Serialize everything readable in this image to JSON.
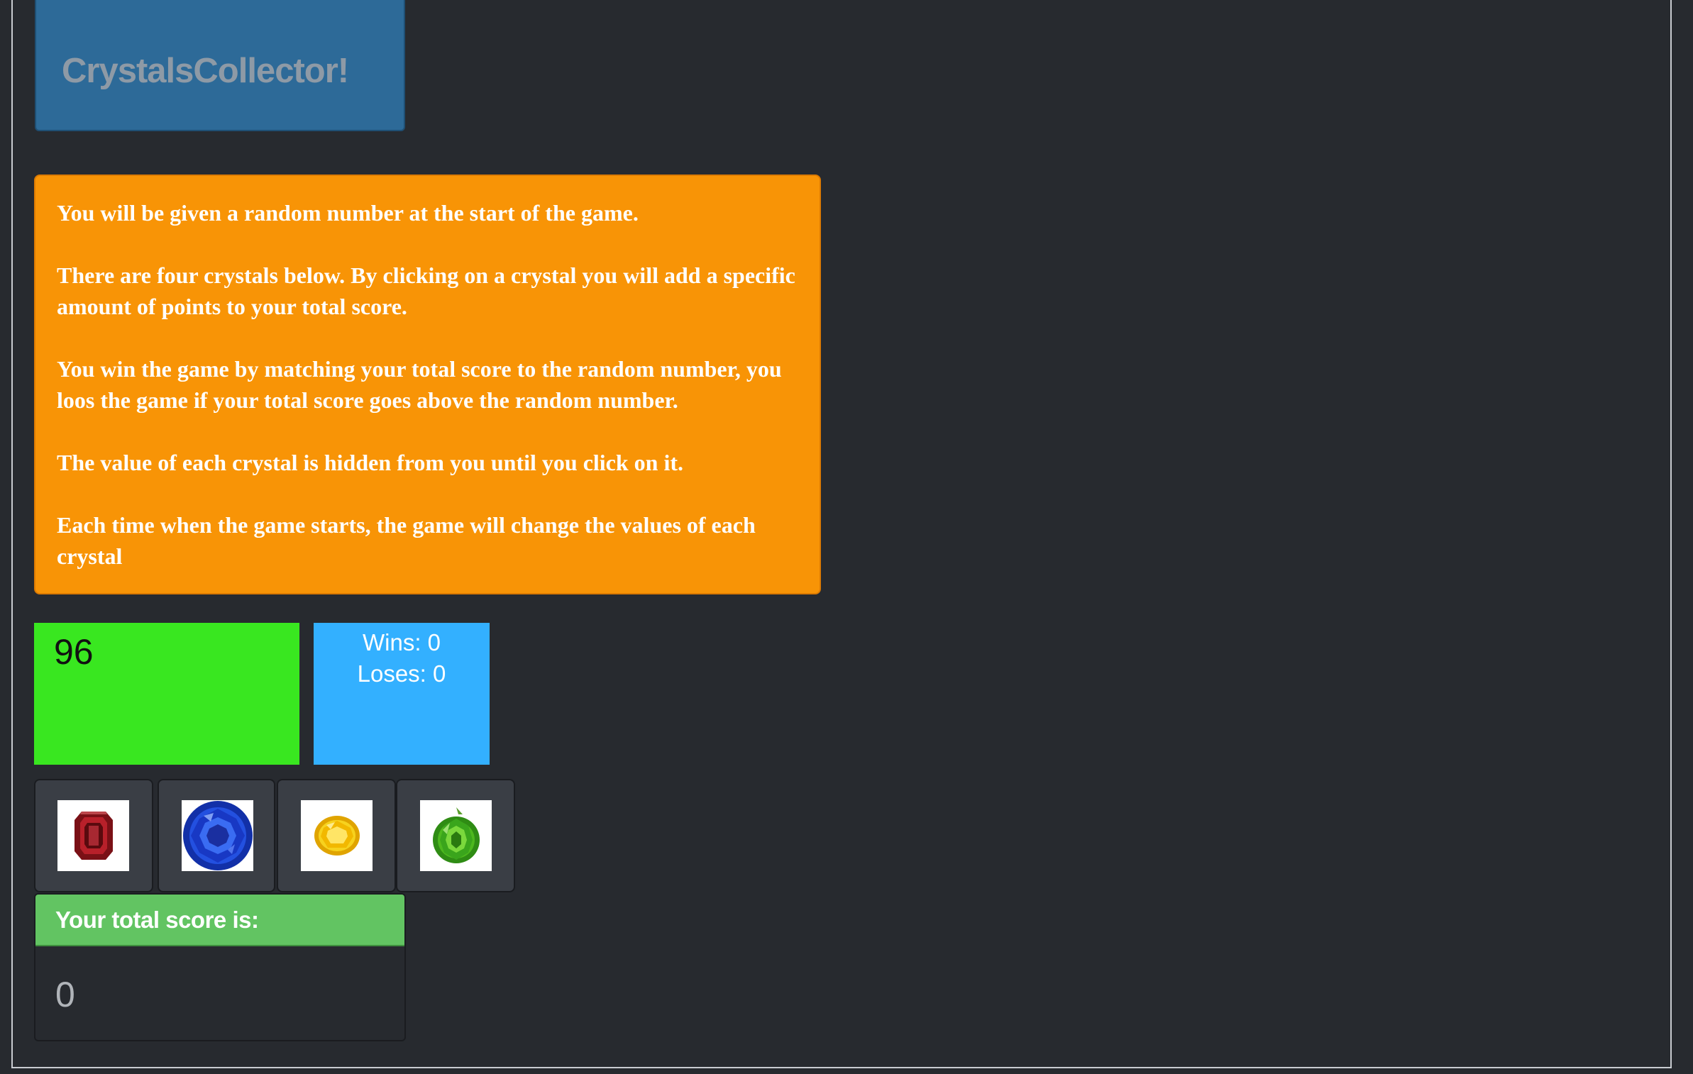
{
  "app": {
    "title": "CrystalsCollector!"
  },
  "rules": [
    "You will be given a random number at the start of the game.",
    "There are four crystals below. By clicking on a crystal you will add a specific amount of points to your total score.",
    "You win the game by matching your total score to the random number, you loos the game if your total score goes above the random number.",
    "The value of each crystal is hidden from you until you click on it.",
    "Each time when the game starts, the game will change the values of each crystal"
  ],
  "target": {
    "number": "96"
  },
  "record": {
    "wins": "Wins: 0",
    "loses": "Loses: 0"
  },
  "crystals": [
    {
      "icon": "red-crystal-icon",
      "color": "#8b1a1a"
    },
    {
      "icon": "blue-crystal-icon",
      "color": "#1f3fd6"
    },
    {
      "icon": "yellow-crystal-icon",
      "color": "#f2c81a"
    },
    {
      "icon": "green-crystal-icon",
      "color": "#3aa51c"
    }
  ],
  "score": {
    "label": "Your total score is:",
    "value": "0"
  },
  "colors": {
    "background": "#272a2f",
    "title_panel": "#2d6a98",
    "rules_panel": "#f89406",
    "target_panel": "#39e720",
    "record_panel": "#33b0ff",
    "score_header": "#62c462"
  }
}
